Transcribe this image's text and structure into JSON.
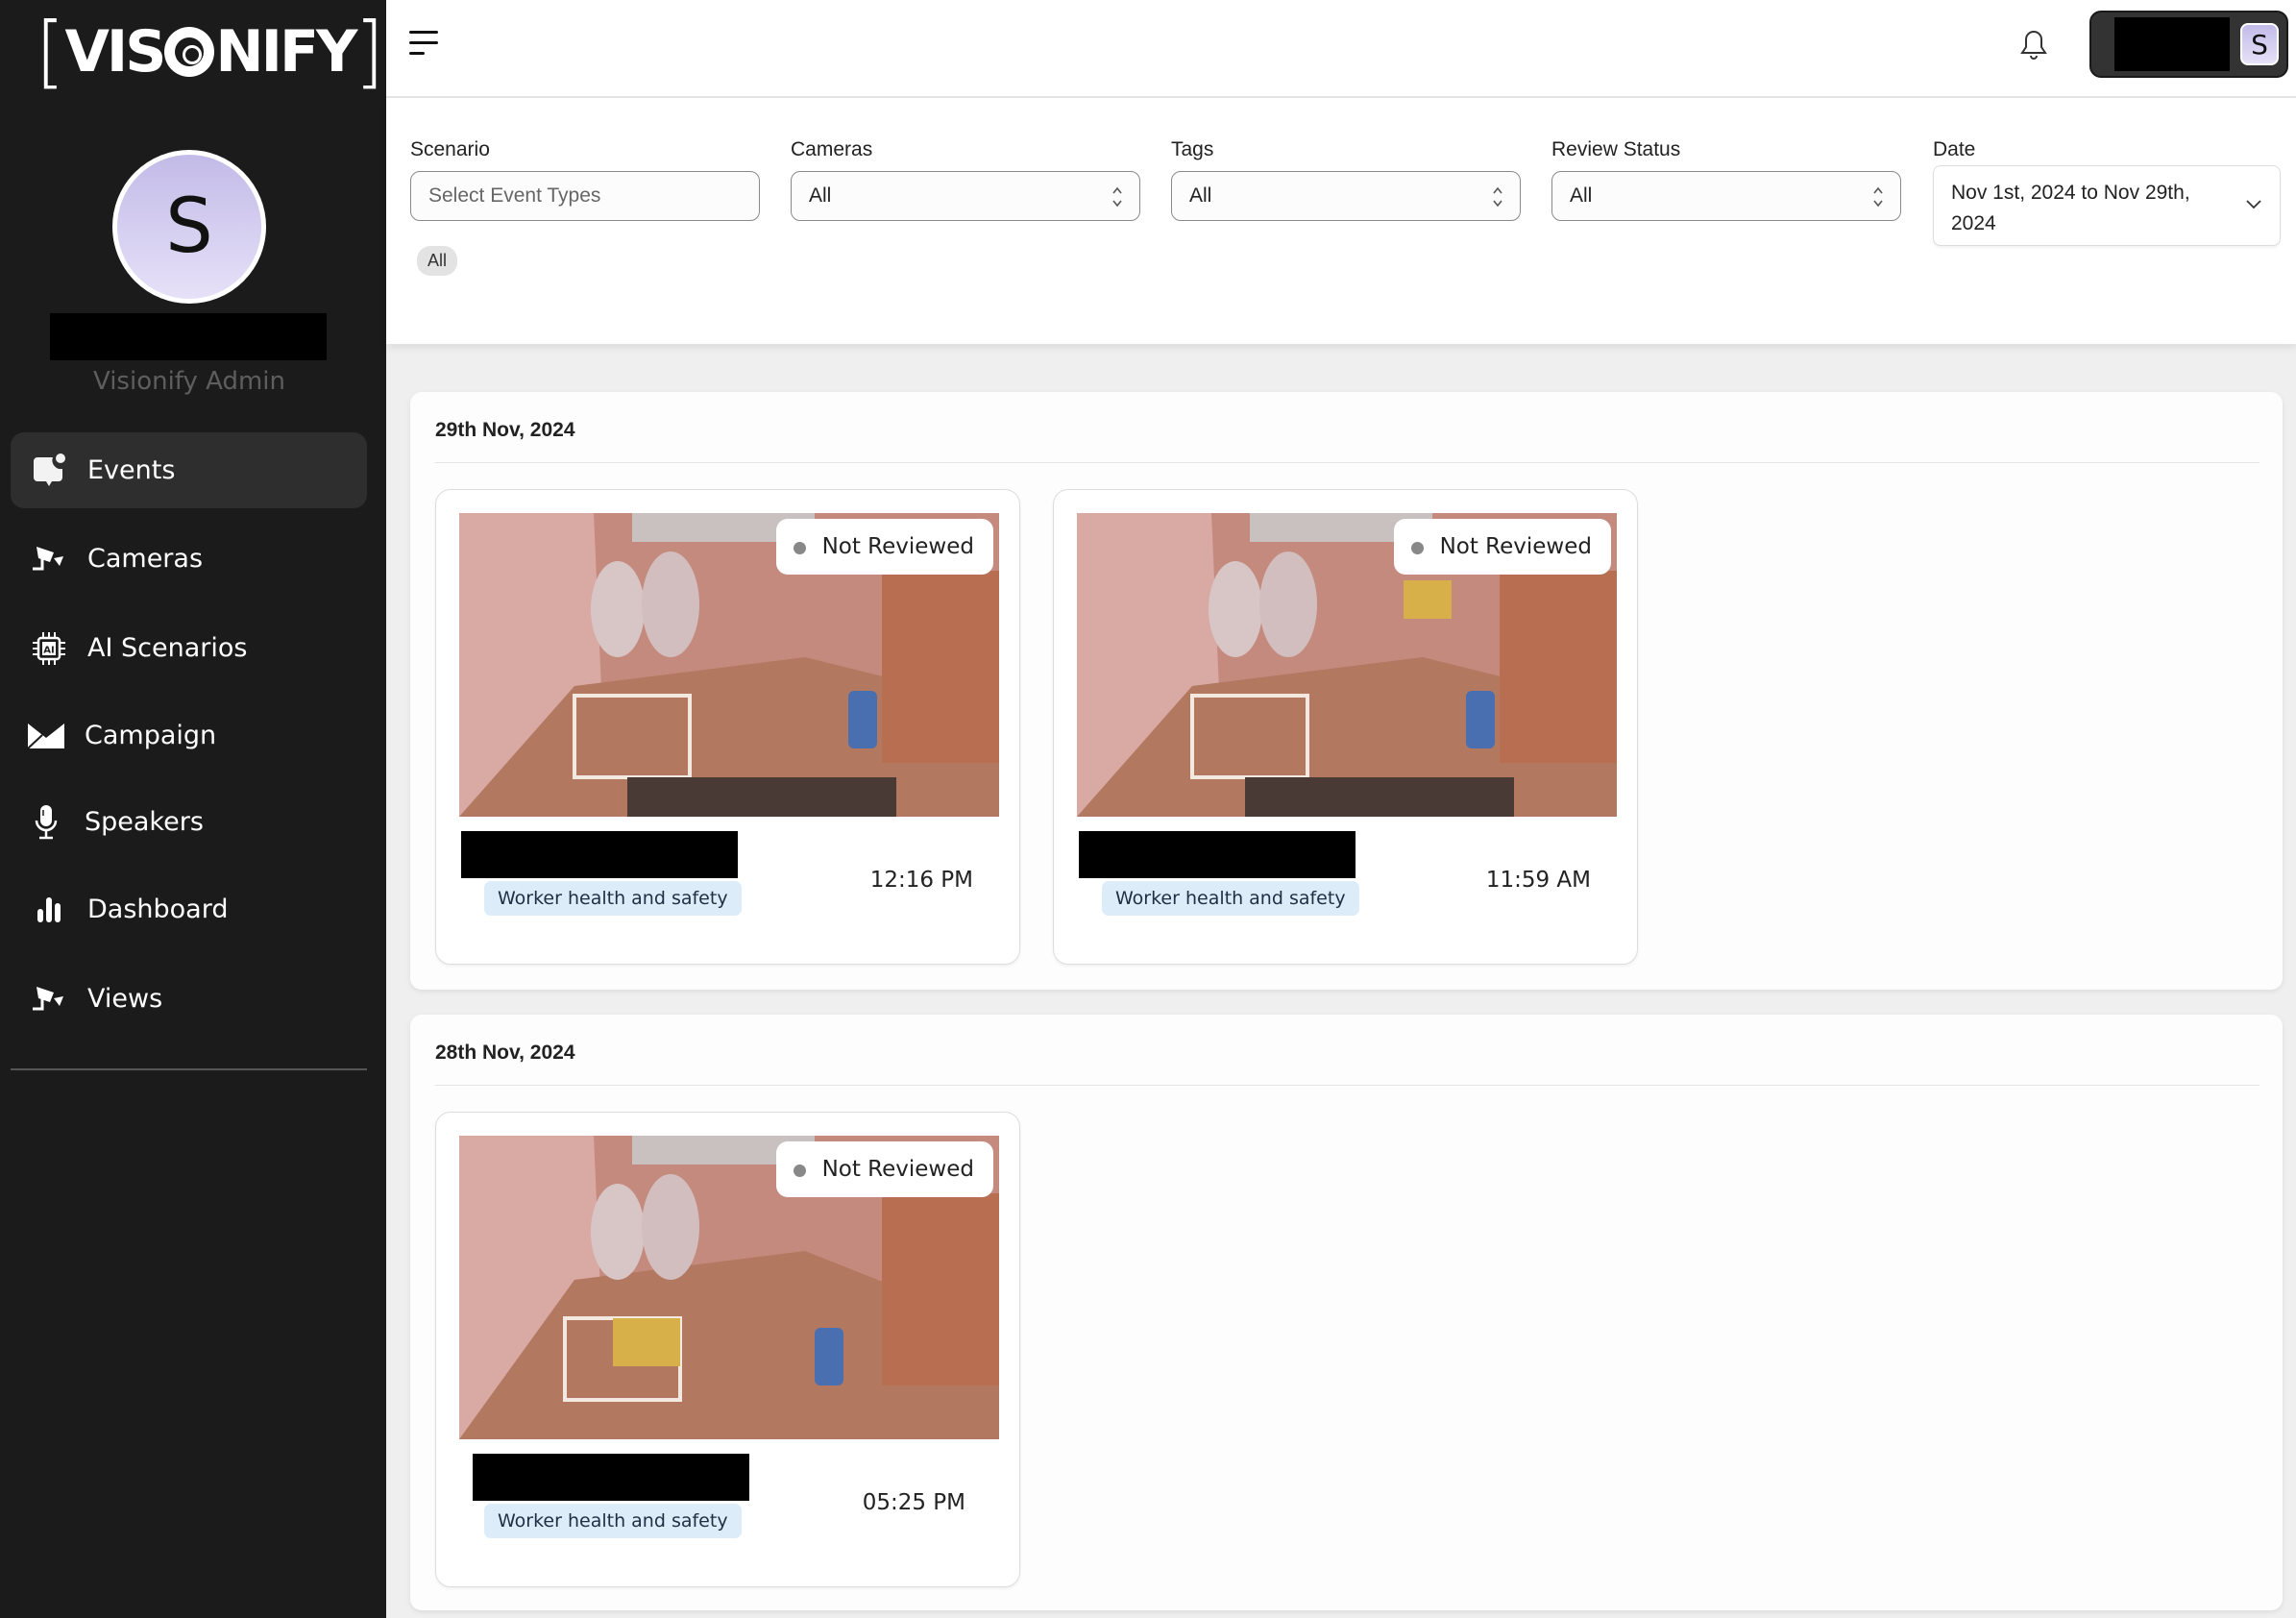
{
  "brand": {
    "logo_text_left": "VIS",
    "logo_text_right": "NIFY",
    "registered_mark": "®"
  },
  "user": {
    "initial": "S",
    "role": "Visionify Admin"
  },
  "sidebar": {
    "items": [
      {
        "label": "Events",
        "icon": "chat-bubble-notification-icon",
        "active": true
      },
      {
        "label": "Cameras",
        "icon": "security-camera-icon",
        "active": false
      },
      {
        "label": "AI Scenarios",
        "icon": "ai-chip-icon",
        "active": false
      },
      {
        "label": "Campaign",
        "icon": "envelope-icon",
        "active": false
      },
      {
        "label": "Speakers",
        "icon": "microphone-icon",
        "active": false
      },
      {
        "label": "Dashboard",
        "icon": "bar-chart-icon",
        "active": false
      },
      {
        "label": "Views",
        "icon": "security-camera-icon",
        "active": false
      }
    ]
  },
  "header": {
    "menu_icon": "menu-icon",
    "notification_icon": "bell-icon",
    "user_initial": "S"
  },
  "filters": {
    "scenario": {
      "label": "Scenario",
      "placeholder": "Select Event Types",
      "value": ""
    },
    "cameras": {
      "label": "Cameras",
      "value": "All"
    },
    "tags": {
      "label": "Tags",
      "value": "All"
    },
    "review_status": {
      "label": "Review Status",
      "value": "All"
    },
    "date": {
      "label": "Date",
      "value": "Nov 1st, 2024 to Nov 29th, 2024"
    },
    "selected_chip": "All"
  },
  "event_groups": [
    {
      "date": "29th Nov, 2024",
      "events": [
        {
          "status": "Not Reviewed",
          "tag": "Worker health and safety",
          "time": "12:16 PM"
        },
        {
          "status": "Not Reviewed",
          "tag": "Worker health and safety",
          "time": "11:59 AM"
        }
      ]
    },
    {
      "date": "28th Nov, 2024",
      "events": [
        {
          "status": "Not Reviewed",
          "tag": "Worker health and safety",
          "time": "05:25 PM"
        }
      ]
    }
  ],
  "colors": {
    "sidebar_bg": "#1b1b1b",
    "active_nav_bg": "#2e2e2e",
    "avatar_bg": "#d3cdf0",
    "tag_bg": "#dcecf8",
    "status_dot": "#888888"
  }
}
